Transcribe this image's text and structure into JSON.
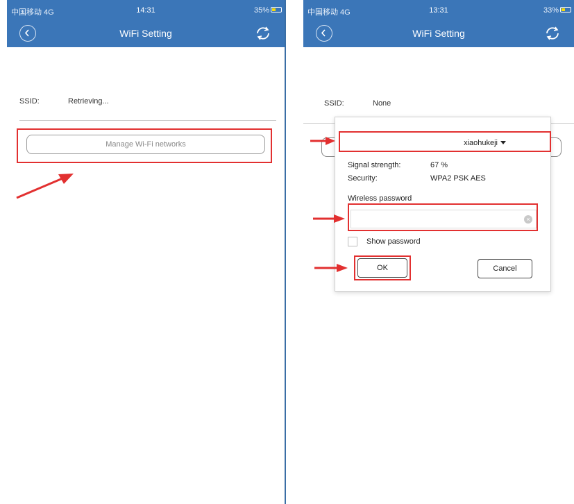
{
  "left": {
    "status": {
      "carrier": "中国移动 4G",
      "time": "14:31",
      "battery": "35%",
      "battery_level": 0.35
    },
    "nav": {
      "title": "WiFi Setting"
    },
    "ssid": {
      "label": "SSID:",
      "value": "Retrieving..."
    },
    "manage_button": "Manage Wi-Fi networks"
  },
  "right": {
    "status": {
      "carrier": "中国移动 4G",
      "time": "13:31",
      "battery": "33%",
      "battery_level": 0.33
    },
    "nav": {
      "title": "WiFi Setting"
    },
    "ssid": {
      "label": "SSID:",
      "value": "None"
    },
    "dialog": {
      "network": "xiaohukeji",
      "signal_label": "Signal strength:",
      "signal_value": "67 %",
      "security_label": "Security:",
      "security_value": "WPA2 PSK AES",
      "password_label": "Wireless password",
      "password_value": "",
      "show_password_label": "Show password",
      "show_password_checked": false,
      "ok_label": "OK",
      "cancel_label": "Cancel"
    }
  },
  "colors": {
    "header": "#3b76b8",
    "highlight": "#e23030"
  },
  "icons": [
    "back-icon",
    "refresh-icon",
    "battery-icon",
    "dropdown-caret-icon",
    "clear-icon",
    "red-arrow-icon"
  ]
}
